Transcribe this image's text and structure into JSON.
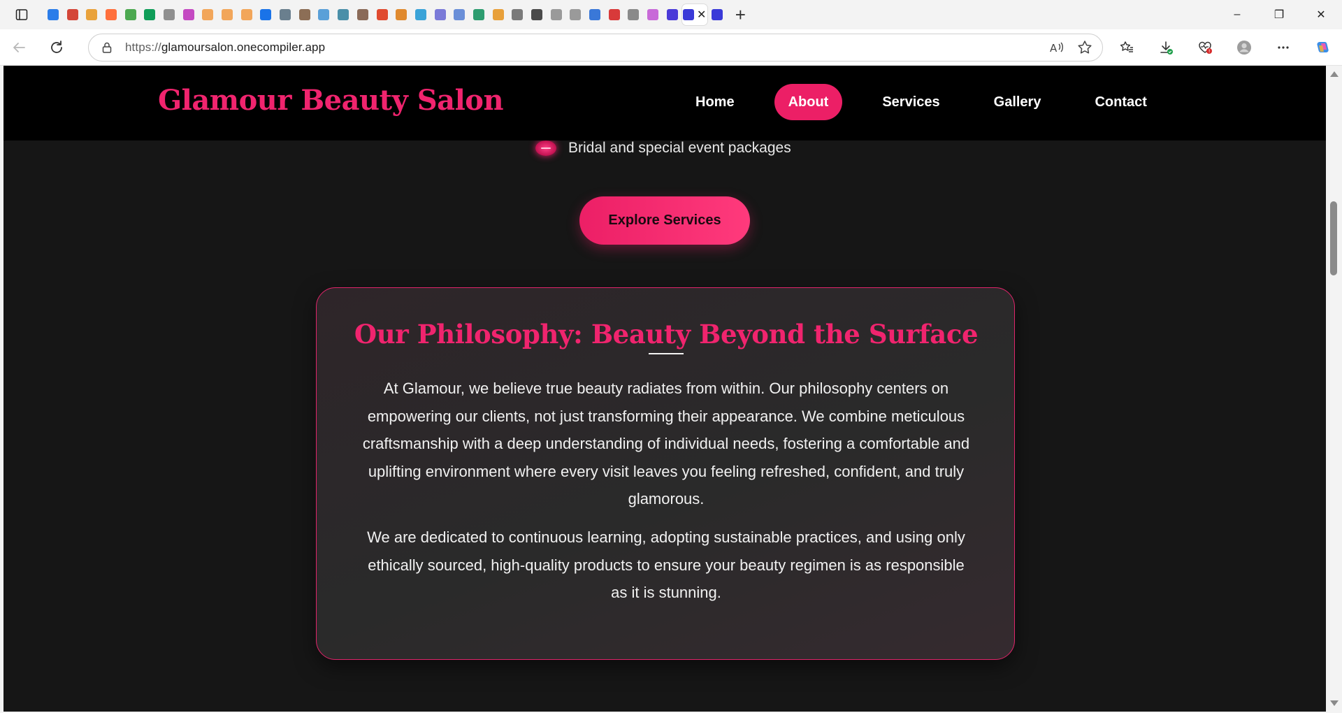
{
  "browser": {
    "url_prefix": "https://",
    "url_host": "glamoursalon.onecompiler.app",
    "favicon_colors": [
      "#2b7de9",
      "#d44638",
      "#e9a23b",
      "#ff6f3c",
      "#4ca850",
      "#0f9d58",
      "#8f8f8f",
      "#c44ac2",
      "#f2a65a",
      "#f2a65a",
      "#f2a65a",
      "#1a73e8",
      "#6a7f8e",
      "#8c6e56",
      "#5aa0d8",
      "#4a8fa8",
      "#8a6a58",
      "#e04a2f",
      "#e08a2f",
      "#3aa3d8",
      "#7a7ad8",
      "#6a8fd8",
      "#2d9c6f",
      "#e8a03a",
      "#7a7a7a",
      "#4a4a4a",
      "#9a9a9a",
      "#9a9a9a",
      "#3a78d8",
      "#d83a3a",
      "#8a8a8a",
      "#c86ad8",
      "#4a3ad8",
      "#3a3ad8"
    ],
    "window_minimize": "–",
    "window_restore": "❐",
    "window_close": "✕"
  },
  "site": {
    "logo": "Glamour Beauty Salon",
    "nav": [
      {
        "label": "Home"
      },
      {
        "label": "About"
      },
      {
        "label": "Services"
      },
      {
        "label": "Gallery"
      },
      {
        "label": "Contact"
      }
    ],
    "active_nav": "About",
    "accent_color": "#ec1f66",
    "bullet_text": "Bridal and special event packages",
    "explore_button": "Explore Services",
    "philosophy": {
      "title": "Our Philosophy: Beauty Beyond the Surface",
      "paragraph_1": "At Glamour, we believe true beauty radiates from within. Our philosophy centers on empowering our clients, not just transforming their appearance. We combine meticulous craftsmanship with a deep understanding of individual needs, fostering a comfortable and uplifting environment where every visit leaves you feeling refreshed, confident, and truly glamorous.",
      "paragraph_2": "We are dedicated to continuous learning, adopting sustainable practices, and using only ethically sourced, high-quality products to ensure your beauty regimen is as responsible as it is stunning."
    }
  }
}
